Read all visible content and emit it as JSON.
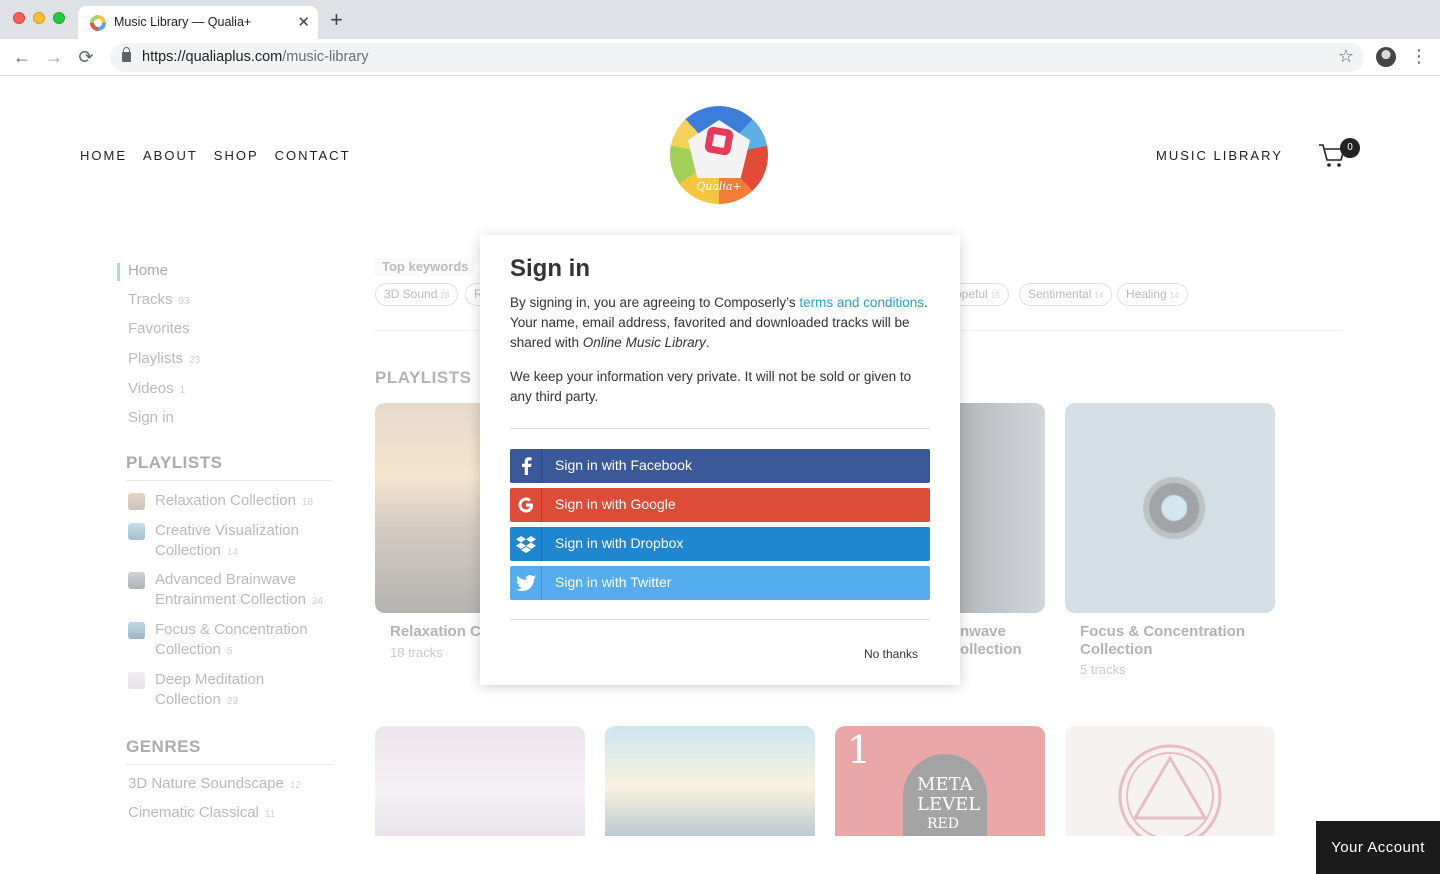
{
  "browser": {
    "tab_title": "Music Library — Qualia+",
    "tab_close": "✕",
    "new_tab": "+",
    "url_host": "https://qualiaplus.com",
    "url_path": "/music-library",
    "back": "←",
    "forward": "→",
    "reload": "⟳",
    "star": "☆",
    "menu": "⋮"
  },
  "site": {
    "nav": [
      "HOME",
      "ABOUT",
      "SHOP",
      "CONTACT"
    ],
    "logo_text": "Qualia+",
    "music_library": "MUSIC LIBRARY",
    "cart_count": "0"
  },
  "sidebar": {
    "items": [
      {
        "label": "Home",
        "count": ""
      },
      {
        "label": "Tracks",
        "count": "93"
      },
      {
        "label": "Favorites",
        "count": ""
      },
      {
        "label": "Playlists",
        "count": "23"
      },
      {
        "label": "Videos",
        "count": "1"
      },
      {
        "label": "Sign in",
        "count": ""
      }
    ],
    "playlists_heading": "PLAYLISTS",
    "playlists": [
      {
        "name": "Relaxation Collection",
        "count": "18"
      },
      {
        "name": "Creative Visualization Collection",
        "count": "14"
      },
      {
        "name": "Advanced Brainwave Entrainment Collection",
        "count": "24"
      },
      {
        "name": "Focus & Concentration Collection",
        "count": "5"
      },
      {
        "name": "Deep Meditation Collection",
        "count": "23"
      }
    ],
    "genres_heading": "GENRES",
    "genres": [
      {
        "name": "3D Nature Soundscape",
        "count": "12"
      },
      {
        "name": "Cinematic Classical",
        "count": "11"
      }
    ]
  },
  "keywords": {
    "label": "Top keywords",
    "chips": [
      {
        "label": "3D Sound",
        "count": "28"
      },
      {
        "label": "R",
        "count": ""
      },
      {
        "label": "opeful",
        "count": "15"
      },
      {
        "label": "Sentimental",
        "count": "14"
      },
      {
        "label": "Healing",
        "count": "14"
      }
    ]
  },
  "main": {
    "section_title": "PLAYLISTS",
    "cards": [
      {
        "title": "Relaxation C",
        "sub": "18 tracks"
      },
      {
        "title": "nwave\nollection",
        "sub": ""
      },
      {
        "title": "Focus & Concentration Collection",
        "sub": "5 tracks"
      }
    ],
    "meta_card": {
      "number": "1",
      "line1": "META",
      "line2": "LEVEL",
      "line3": "RED"
    }
  },
  "modal": {
    "title": "Sign in",
    "p1_before": "By signing in, you are agreeing to Composerly’s ",
    "p1_link": "terms and conditions",
    "p1_middle": ". Your name, email address, favorited and downloaded tracks will be shared with ",
    "p1_em": "Online Music Library",
    "p1_end": ".",
    "p2": "We keep your information very private. It will not be sold or given to any third party.",
    "buttons": [
      {
        "label": "Sign in with Facebook",
        "color": "#3b5998"
      },
      {
        "label": "Sign in with Google",
        "color": "#dd4b39"
      },
      {
        "label": "Sign in with Dropbox",
        "color": "#1f86d0"
      },
      {
        "label": "Sign in with Twitter",
        "color": "#55acee"
      }
    ],
    "no_thanks": "No thanks"
  },
  "your_account": "Your Account"
}
